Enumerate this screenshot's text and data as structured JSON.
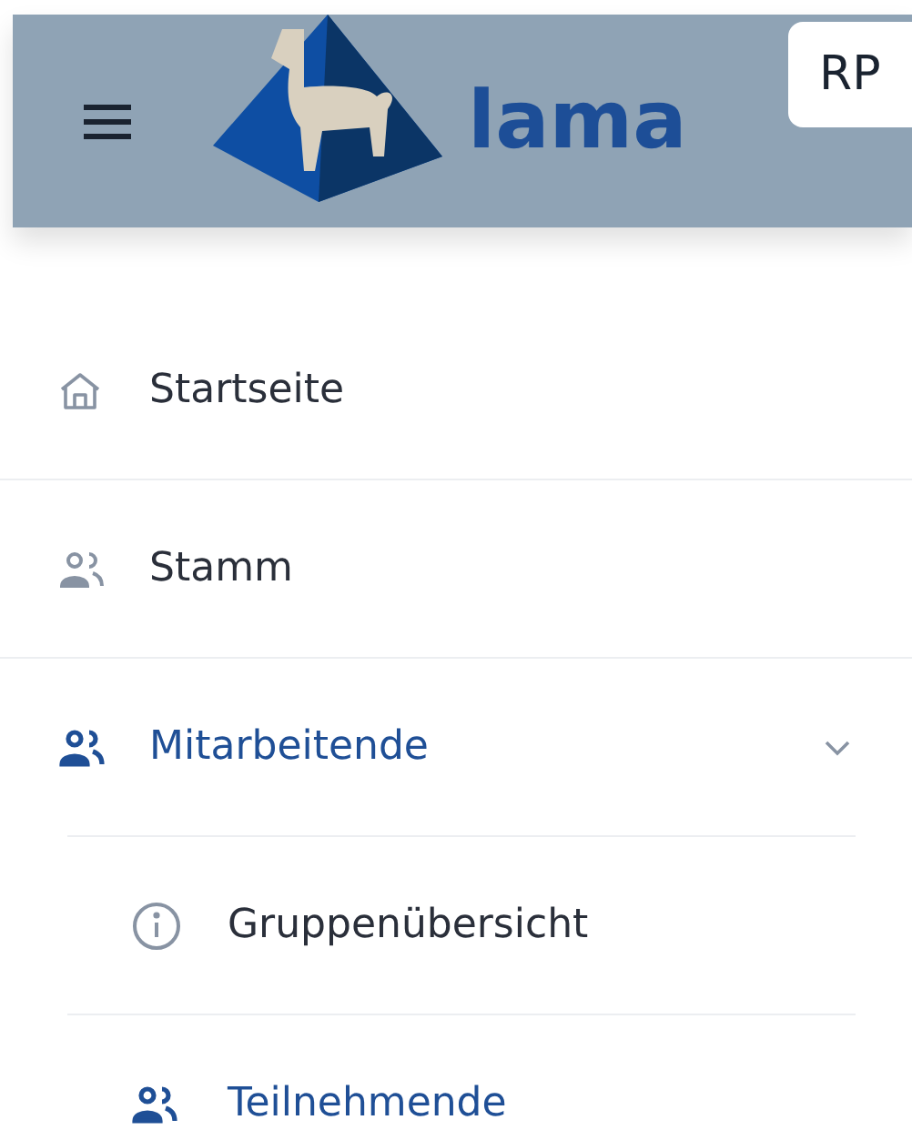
{
  "header": {
    "logo_text": "lama",
    "button_text": "RP"
  },
  "nav": [
    {
      "label": "Startseite",
      "kind": "home",
      "selected": false
    },
    {
      "label": "Stamm",
      "kind": "group",
      "selected": false
    },
    {
      "label": "Mitarbeitende",
      "kind": "group",
      "selected": true,
      "expanded": true,
      "children": [
        {
          "label": "Gruppenübersicht",
          "kind": "overview",
          "selected": false
        },
        {
          "label": "Teilnehmende",
          "kind": "group",
          "selected": true
        }
      ]
    }
  ]
}
